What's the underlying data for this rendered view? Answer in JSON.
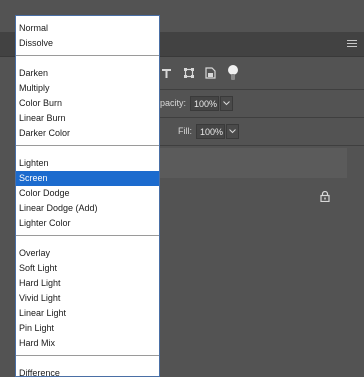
{
  "blend_menu": {
    "selected_value": "Screen",
    "groups": [
      [
        "Normal",
        "Dissolve"
      ],
      [
        "Darken",
        "Multiply",
        "Color Burn",
        "Linear Burn",
        "Darker Color"
      ],
      [
        "Lighten",
        "Screen",
        "Color Dodge",
        "Linear Dodge (Add)",
        "Lighter Color"
      ],
      [
        "Overlay",
        "Soft Light",
        "Hard Light",
        "Vivid Light",
        "Linear Light",
        "Pin Light",
        "Hard Mix"
      ],
      [
        "Difference"
      ]
    ]
  },
  "layers_panel": {
    "filter_icons": [
      "text-layer-filter-icon",
      "shape-layer-filter-icon",
      "smart-object-filter-icon",
      "filter-toggle-icon"
    ],
    "opacity_label": "pacity:",
    "opacity_value": "100%",
    "fill_label": "Fill:",
    "fill_value": "100%",
    "lock_icon": "lock-icon"
  },
  "colors": {
    "panel_bg": "#535353",
    "panel_header": "#424242",
    "menu_bg": "#ffffff",
    "menu_highlight": "#1c6bce"
  }
}
